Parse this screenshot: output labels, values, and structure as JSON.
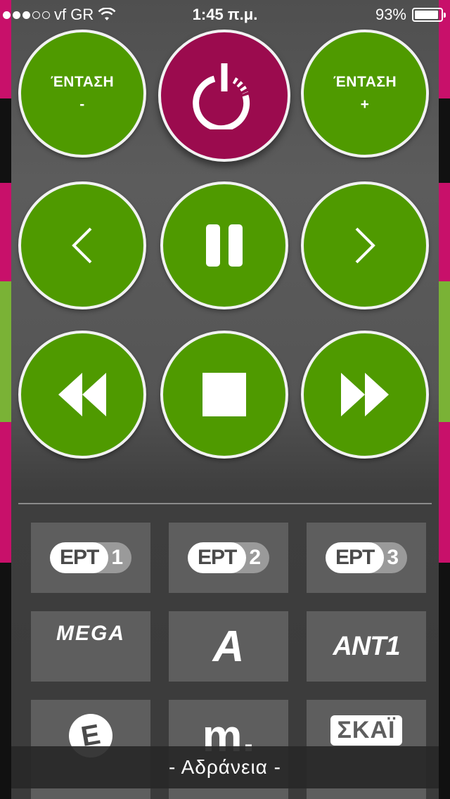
{
  "status_bar": {
    "carrier": "vf GR",
    "time": "1:45 π.μ.",
    "battery": "93%",
    "battery_level": 0.93,
    "signal_bars_filled": 3,
    "signal_bars_total": 5
  },
  "controls": {
    "volume_down": {
      "title": "ΈΝΤΑΣΗ",
      "sign": "-"
    },
    "volume_up": {
      "title": "ΈΝΤΑΣΗ",
      "sign": "+"
    },
    "power_icon": "power-icon",
    "previous_icon": "chevron-left-icon",
    "pause_icon": "pause-icon",
    "next_icon": "chevron-right-icon",
    "rewind_icon": "rewind-icon",
    "stop_icon": "stop-icon",
    "fast_forward_icon": "fast-forward-icon"
  },
  "channels": [
    {
      "name": "ΕΡΤ",
      "number": "1"
    },
    {
      "name": "ΕΡΤ",
      "number": "2"
    },
    {
      "name": "ΕΡΤ",
      "number": "3"
    },
    {
      "name": "MEGA"
    },
    {
      "name": "A"
    },
    {
      "name": "ANT1"
    },
    {
      "name": "E"
    },
    {
      "name": "m."
    },
    {
      "name": "ΣΚΑΪ"
    }
  ],
  "idle_label": "- Αδράνεια -",
  "colors": {
    "button_green": "#4f9a00",
    "power_magenta": "#9b0b4e",
    "tile_gray": "#5e5e5e"
  }
}
